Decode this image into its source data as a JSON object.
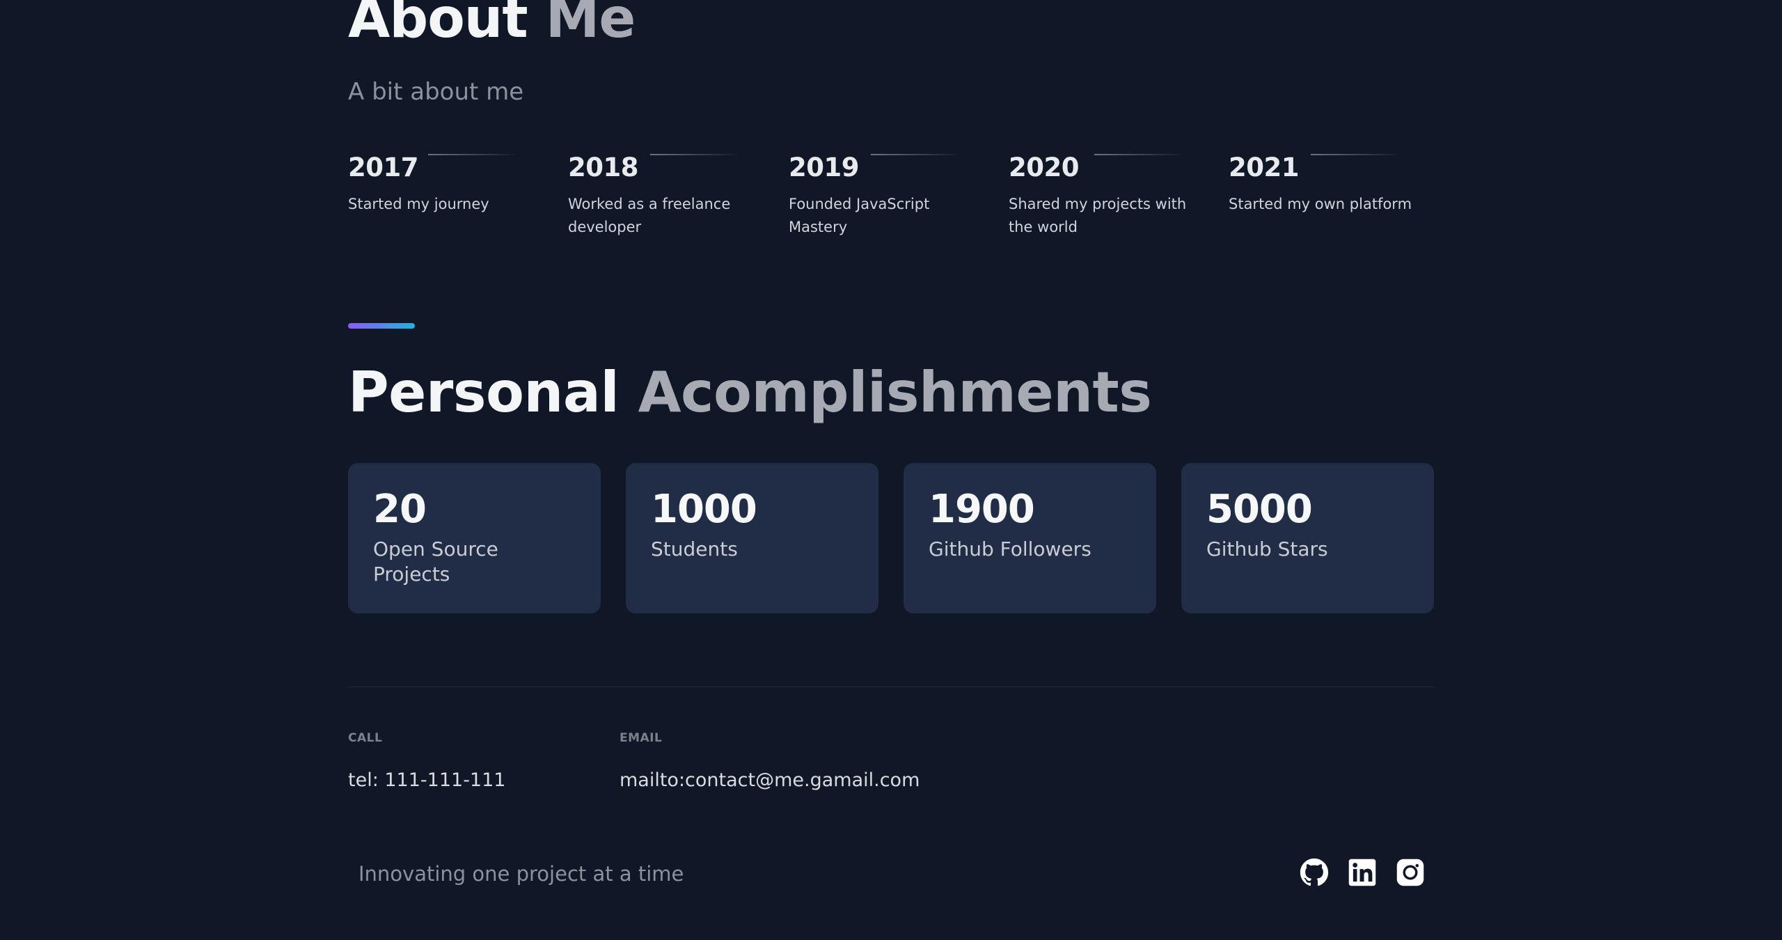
{
  "about": {
    "title_part1": "About",
    "title_part2": "Me",
    "subtitle": "A bit about me"
  },
  "timeline": [
    {
      "year": "2017",
      "text": "Started my journey"
    },
    {
      "year": "2018",
      "text": "Worked as a freelance developer"
    },
    {
      "year": "2019",
      "text": "Founded JavaScript Mastery"
    },
    {
      "year": "2020",
      "text": "Shared my projects with the world"
    },
    {
      "year": "2021",
      "text": "Started my own platform"
    }
  ],
  "accomplishments": {
    "title_part1": "Personal",
    "title_part2": "Acomplishments",
    "cards": [
      {
        "number": "20",
        "label": "Open Source Projects"
      },
      {
        "number": "1000",
        "label": "Students"
      },
      {
        "number": "1900",
        "label": "Github Followers"
      },
      {
        "number": "5000",
        "label": "Github Stars"
      }
    ]
  },
  "contact": {
    "call_label": "CALL",
    "call_value": "tel: 111-111-111",
    "email_label": "EMAIL",
    "email_value": "mailto:contact@me.gamail.com"
  },
  "footer": {
    "tagline": "Innovating one project at a time",
    "socials": [
      {
        "icon": "github-icon"
      },
      {
        "icon": "linkedin-icon"
      },
      {
        "icon": "instagram-icon"
      }
    ]
  },
  "colors": {
    "background": "#101726",
    "card": "#212c46",
    "accent_start": "#8b5cf6",
    "accent_end": "#22b3d8"
  }
}
